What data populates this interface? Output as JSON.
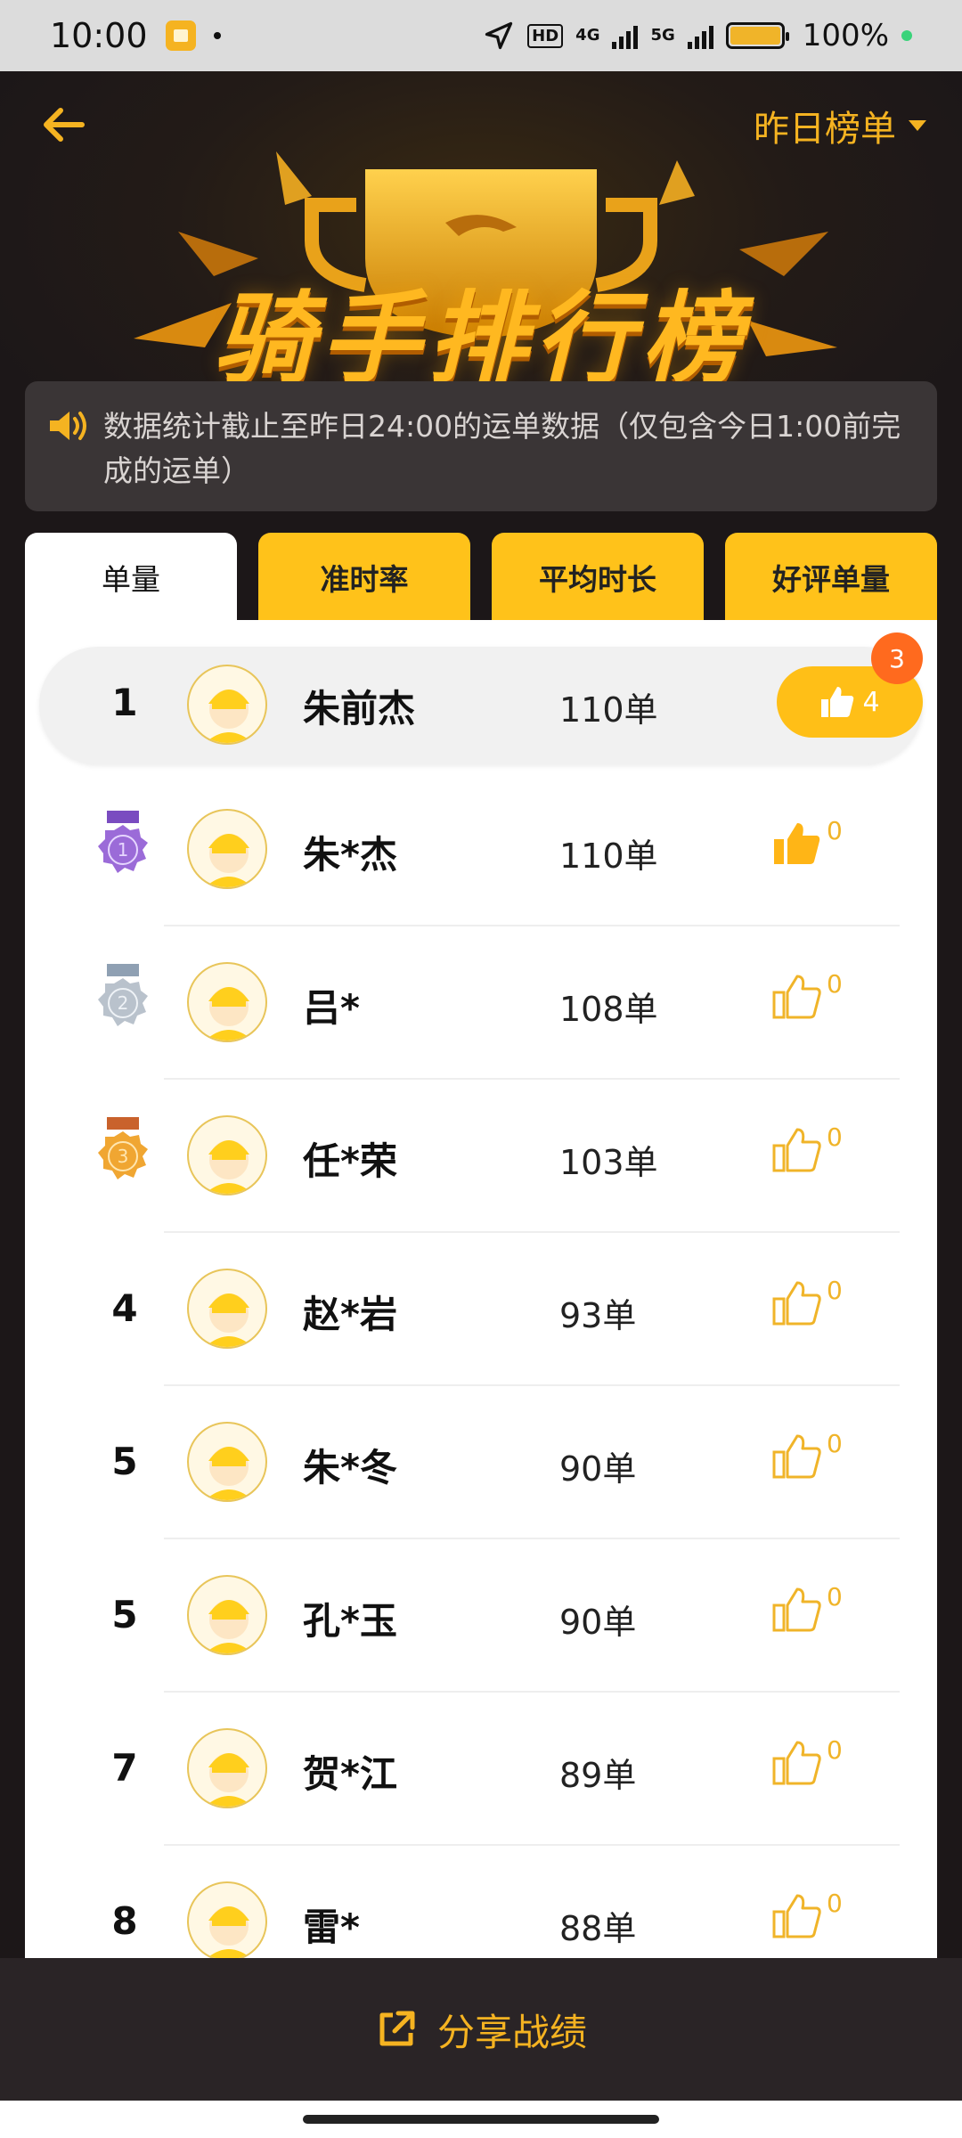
{
  "status_bar": {
    "time": "10:00",
    "hd": "HD",
    "net1": "4G",
    "net2": "5G",
    "battery": "100%"
  },
  "header": {
    "title": "骑手排行榜",
    "board_selector": "昨日榜单"
  },
  "notice": {
    "text": "数据统计截止至昨日24:00的运单数据（仅包含今日1:00前完成的运单）"
  },
  "tabs": [
    {
      "label": "单量",
      "active": true
    },
    {
      "label": "准时率",
      "active": false
    },
    {
      "label": "平均时长",
      "active": false
    },
    {
      "label": "好评单量",
      "active": false
    }
  ],
  "my_row": {
    "rank": "1",
    "name": "朱前杰",
    "count": "110单",
    "likes": "4",
    "badge": "3"
  },
  "rows": [
    {
      "rank": "1",
      "medal": "purple",
      "name": "朱*杰",
      "count": "110单",
      "likes": "0"
    },
    {
      "rank": "2",
      "medal": "silver",
      "name": "吕*",
      "count": "108单",
      "likes": "0"
    },
    {
      "rank": "3",
      "medal": "bronze",
      "name": "任*荣",
      "count": "103单",
      "likes": "0"
    },
    {
      "rank": "4",
      "name": "赵*岩",
      "count": "93单",
      "likes": "0"
    },
    {
      "rank": "5",
      "name": "朱*冬",
      "count": "90单",
      "likes": "0"
    },
    {
      "rank": "5",
      "name": "孔*玉",
      "count": "90单",
      "likes": "0"
    },
    {
      "rank": "7",
      "name": "贺*江",
      "count": "89单",
      "likes": "0"
    },
    {
      "rank": "8",
      "name": "雷*",
      "count": "88单",
      "likes": "0"
    }
  ],
  "bottom": {
    "share_label": "分享战绩"
  },
  "colors": {
    "accent": "#ffc21a",
    "dark_bg": "#1c1718",
    "badge": "#ff6a1e"
  }
}
